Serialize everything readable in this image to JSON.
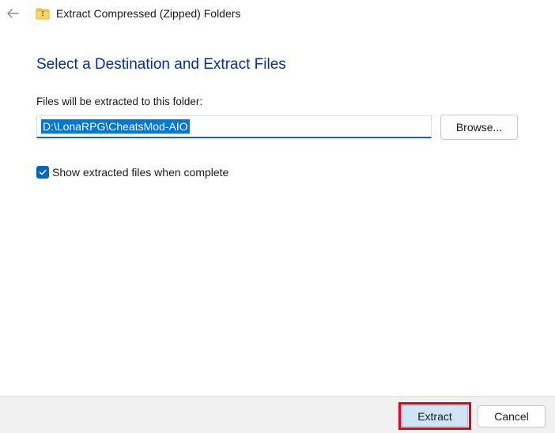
{
  "titlebar": {
    "back_icon": "arrow-left-icon",
    "folder_icon": "zipped-folder-icon",
    "title": "Extract Compressed (Zipped) Folders"
  },
  "main": {
    "heading": "Select a Destination and Extract Files",
    "folder_label": "Files will be extracted to this folder:",
    "path_value": "D:\\LonaRPG\\CheatsMod-AIO",
    "browse_label": "Browse...",
    "show_files_label": "Show extracted files when complete",
    "show_files_checked": true
  },
  "footer": {
    "extract_label": "Extract",
    "cancel_label": "Cancel"
  },
  "colors": {
    "heading": "#003399",
    "selection": "#0078d7",
    "checkbox": "#0067c0",
    "highlight_box": "#e2001a"
  }
}
